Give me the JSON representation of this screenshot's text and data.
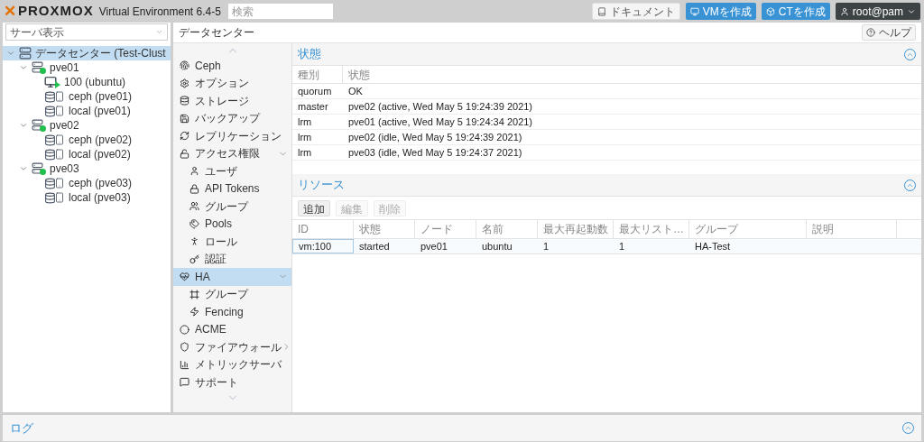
{
  "header": {
    "logo_mark": "✕",
    "logo": "PROXMOX",
    "version": "Virtual Environment 6.4-5",
    "search": {
      "placeholder": "検索"
    },
    "buttons": [
      {
        "label": "ドキュメント",
        "kind": "docs"
      },
      {
        "label": "VMを作成",
        "kind": "vm"
      },
      {
        "label": "CTを作成",
        "kind": "ct"
      }
    ],
    "user": "root@pam"
  },
  "sidebar": {
    "view_select": "サーバ表示",
    "tree": [
      {
        "label": "データセンター (Test-Clust",
        "kind": "datacenter",
        "selected": true,
        "expanded": true,
        "children": [
          {
            "label": "pve01",
            "kind": "node",
            "selected": false,
            "expanded": true,
            "children": [
              {
                "label": "100 (ubuntu)",
                "kind": "vm",
                "selected": false
              },
              {
                "label": "ceph (pve01)",
                "kind": "storage",
                "selected": false
              },
              {
                "label": "local (pve01)",
                "kind": "storage",
                "selected": false
              }
            ]
          },
          {
            "label": "pve02",
            "kind": "node",
            "selected": false,
            "expanded": true,
            "children": [
              {
                "label": "ceph (pve02)",
                "kind": "storage",
                "selected": false
              },
              {
                "label": "local (pve02)",
                "kind": "storage",
                "selected": false
              }
            ]
          },
          {
            "label": "pve03",
            "kind": "node",
            "selected": false,
            "expanded": true,
            "children": [
              {
                "label": "ceph (pve03)",
                "kind": "storage",
                "selected": false
              },
              {
                "label": "local (pve03)",
                "kind": "storage",
                "selected": false
              }
            ]
          }
        ]
      }
    ]
  },
  "breadcrumb": "データセンター",
  "help_button": "ヘルプ",
  "nav": [
    {
      "label": "Ceph",
      "selected": false
    },
    {
      "label": "オプション",
      "selected": false
    },
    {
      "label": "ストレージ",
      "selected": false
    },
    {
      "label": "バックアップ",
      "selected": false
    },
    {
      "label": "レプリケーション",
      "selected": false
    },
    {
      "label": "アクセス権限",
      "selected": false,
      "expanded": true,
      "children": [
        {
          "label": "ユーザ",
          "selected": false
        },
        {
          "label": "API Tokens",
          "selected": false
        },
        {
          "label": "グループ",
          "selected": false
        },
        {
          "label": "Pools",
          "selected": false
        },
        {
          "label": "ロール",
          "selected": false
        },
        {
          "label": "認証",
          "selected": false
        }
      ]
    },
    {
      "label": "HA",
      "selected": true,
      "expanded": true,
      "children": [
        {
          "label": "グループ",
          "selected": false
        },
        {
          "label": "Fencing",
          "selected": false
        }
      ]
    },
    {
      "label": "ACME",
      "selected": false
    },
    {
      "label": "ファイアウォール",
      "selected": false,
      "expanded": false
    },
    {
      "label": "メトリックサーバ",
      "selected": false
    },
    {
      "label": "サポート",
      "selected": false
    }
  ],
  "status_panel": {
    "title": "状態",
    "columns": [
      "種別",
      "状態"
    ],
    "rows": [
      [
        "quorum",
        "OK"
      ],
      [
        "master",
        "pve02 (active, Wed May 5 19:24:39 2021)"
      ],
      [
        "lrm",
        "pve01 (active, Wed May 5 19:24:34 2021)"
      ],
      [
        "lrm",
        "pve02 (idle, Wed May 5 19:24:39 2021)"
      ],
      [
        "lrm",
        "pve03 (idle, Wed May 5 19:24:37 2021)"
      ]
    ]
  },
  "resources_panel": {
    "title": "リソース",
    "toolbar": [
      {
        "label": "追加",
        "disabled": false
      },
      {
        "label": "編集",
        "disabled": true
      },
      {
        "label": "削除",
        "disabled": true
      }
    ],
    "columns": [
      "ID",
      "状態",
      "ノード",
      "名前",
      "最大再起動数",
      "最大リスト…",
      "グループ",
      "説明"
    ],
    "rows": [
      {
        "cells": [
          "vm:100",
          "started",
          "pve01",
          "ubuntu",
          "1",
          "1",
          "HA-Test",
          ""
        ],
        "selected": true
      }
    ]
  },
  "log_panel": {
    "title": "ログ"
  }
}
